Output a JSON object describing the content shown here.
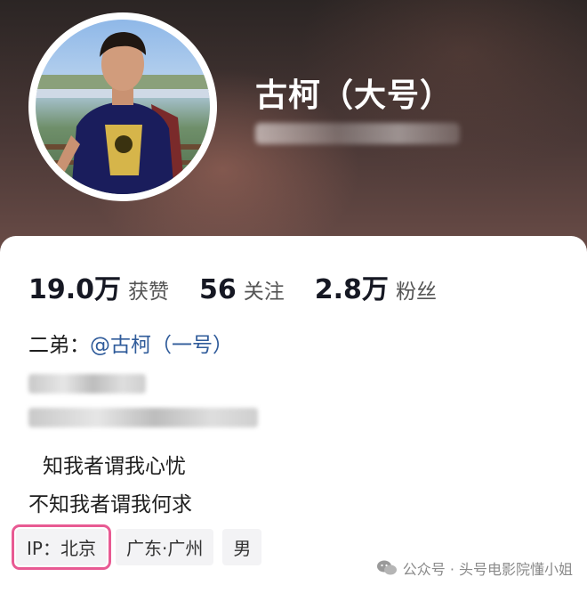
{
  "profile": {
    "nickname": "古柯（大号）"
  },
  "stats": [
    {
      "value": "19.0万",
      "label": "获赞"
    },
    {
      "value": "56",
      "label": "关注"
    },
    {
      "value": "2.8万",
      "label": "粉丝"
    }
  ],
  "bio": {
    "sibling_prefix": "二弟：",
    "sibling_mention": "@古柯（一号）",
    "line1": "知我者谓我心忧",
    "line2": "不知我者谓我何求"
  },
  "tags": {
    "ip": "IP：北京",
    "location": "广东·广州",
    "gender": "男"
  },
  "watermark": "公众号 · 头号电影院懂小姐",
  "colors": {
    "mention": "#2f5b9a",
    "highlight": "#e85a93"
  },
  "icons": {
    "watermark": "wechat-icon"
  }
}
